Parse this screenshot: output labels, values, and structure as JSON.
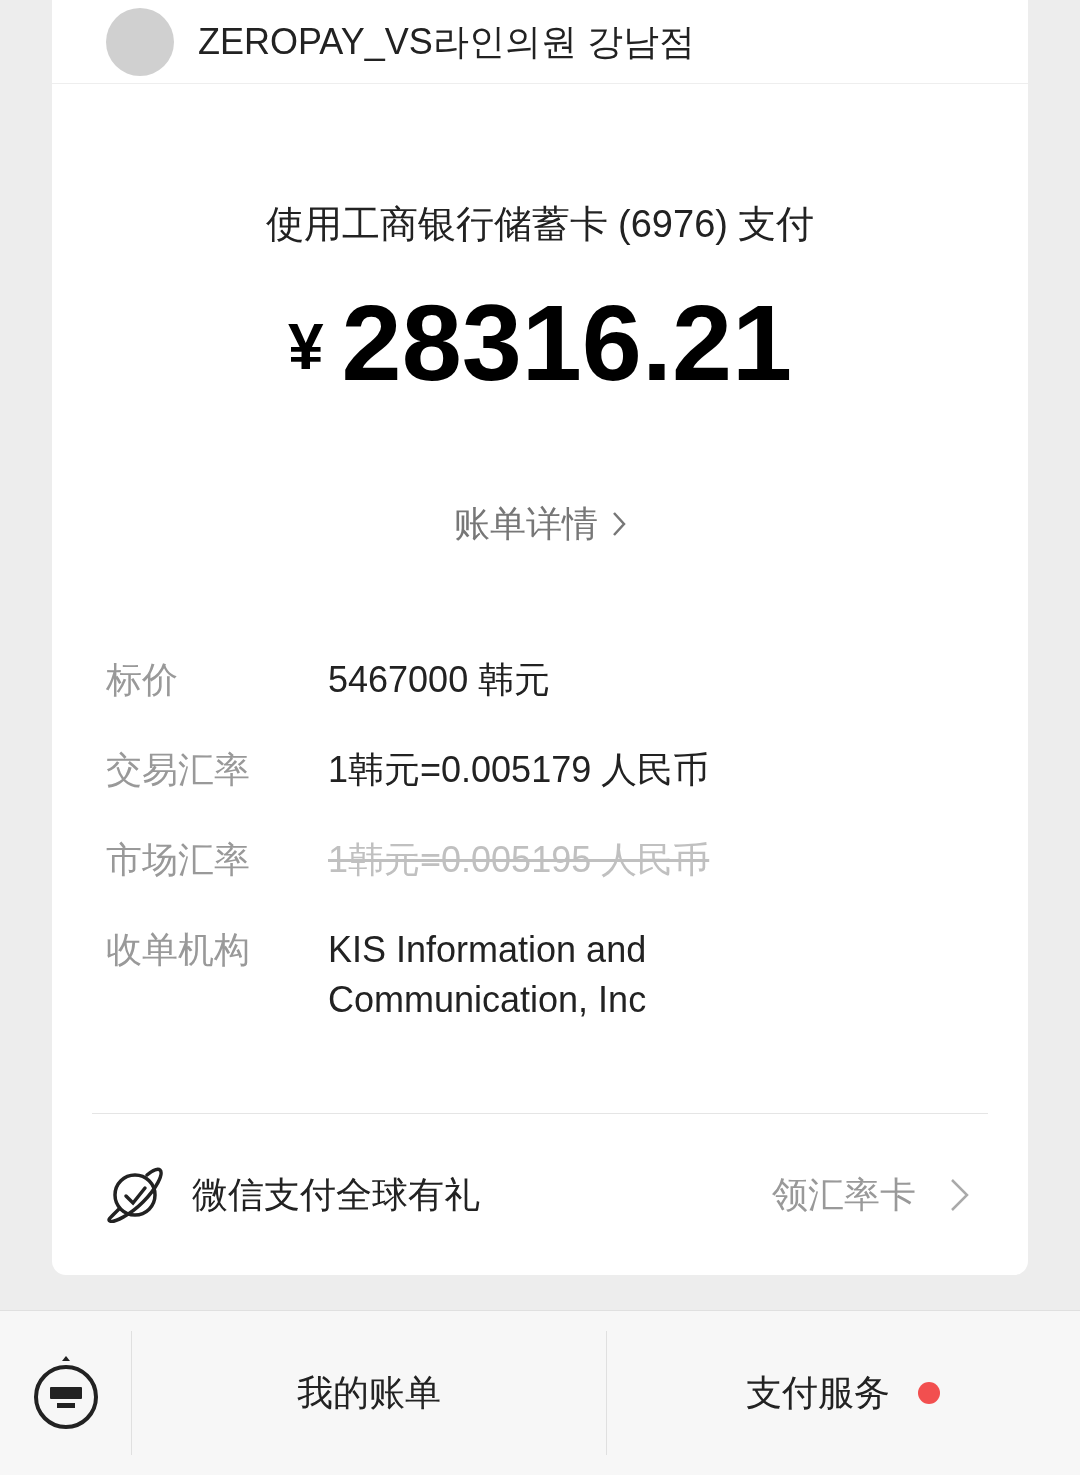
{
  "merchant": {
    "name": "ZEROPAY_VS라인의원 강남점"
  },
  "payment": {
    "method": "使用工商银行储蓄卡 (6976) 支付",
    "currency": "¥",
    "amount": "28316.21",
    "details_link": "账单详情"
  },
  "details": [
    {
      "label": "标价",
      "value": "5467000 韩元",
      "strikethrough": false
    },
    {
      "label": "交易汇率",
      "value": "1韩元=0.005179 人民币",
      "strikethrough": false
    },
    {
      "label": "市场汇率",
      "value": "1韩元=0.005195 人民币",
      "strikethrough": true
    },
    {
      "label": "收单机构",
      "value": "KIS Information and Communication, Inc",
      "strikethrough": false
    }
  ],
  "promo": {
    "title": "微信支付全球有礼",
    "action": "领汇率卡"
  },
  "menu_bar": [
    {
      "label": "我的账单",
      "badge": false
    },
    {
      "label": "支付服务",
      "badge": true
    }
  ]
}
